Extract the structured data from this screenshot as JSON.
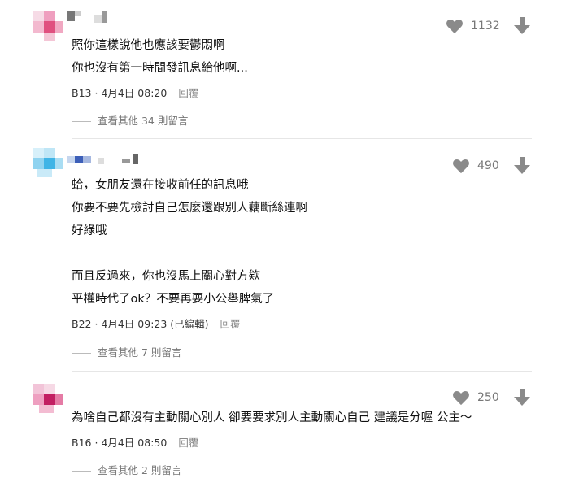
{
  "comments": [
    {
      "lines": [
        "照你這樣說他也應該要鬱悶啊",
        "你也沒有第一時間發訊息給他啊..."
      ],
      "floor": "B13",
      "date": "4月4日 08:20",
      "reply_label": "回覆",
      "likes": "1132",
      "more_replies": "查看其他 34 則留言"
    },
    {
      "lines": [
        "蛤，女朋友還在接收前任的訊息哦",
        "你要不要先檢討自己怎麼還跟別人藕斷絲連啊",
        "好綠哦",
        "",
        "而且反過來，你也沒馬上關心對方欸",
        "平權時代了ok？不要再耍小公舉脾氣了"
      ],
      "floor": "B22",
      "date": "4月4日 09:23 (已編輯)",
      "reply_label": "回覆",
      "likes": "490",
      "more_replies": "查看其他 7 則留言"
    },
    {
      "lines": [
        "為啥自己都沒有主動關心別人 卻要要求別人主動關心自己 建議是分喔 公主～"
      ],
      "floor": "B16",
      "date": "4月4日 08:50",
      "reply_label": "回覆",
      "likes": "250",
      "more_replies": "查看其他 2 則留言"
    }
  ],
  "icons": {
    "like": "heart-icon",
    "dislike": "arrow-down-icon"
  },
  "colors": {
    "icon": "#8a8a8a",
    "divider": "#e6e6e6",
    "meta_text": "#333333",
    "muted_text": "#777777"
  }
}
